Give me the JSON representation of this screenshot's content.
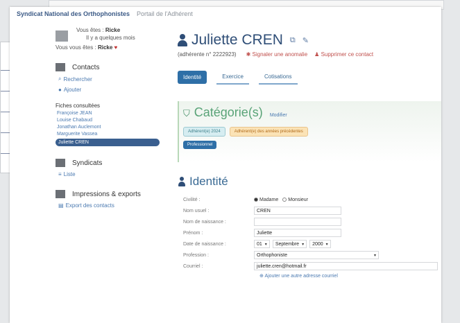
{
  "breadcrumb": {
    "brand": "Syndicat National des Orthophonistes",
    "portal": "Portail de l'Adhérent"
  },
  "user": {
    "line1_prefix": "Vous êtes :",
    "line1_name": "Ricke",
    "line2": "Il y a quelques mois",
    "line3_prefix": "Vous vous êtes :",
    "line3_value": "Ricke",
    "heart": "♥"
  },
  "sidebar": {
    "contacts_label": "Contacts",
    "contacts_links": [
      {
        "icon": "search-icon",
        "label": "Rechercher"
      },
      {
        "icon": "add-icon",
        "label": "Ajouter"
      }
    ],
    "fiches_header": "Fiches consultées",
    "fiches": [
      {
        "label": "Françoise JEAN",
        "active": false
      },
      {
        "label": "Louise Chabaud",
        "active": false
      },
      {
        "label": "Jonathan Auclemont",
        "active": false
      },
      {
        "label": "Marguerite Vassea",
        "active": false
      },
      {
        "label": "Juliette CREN",
        "active": true
      }
    ],
    "syndicats_label": "Syndicats",
    "syndicats_links": [
      {
        "label": "Liste"
      }
    ],
    "exports_label": "Impressions & exports",
    "exports_links": [
      {
        "label": "Export des contacts"
      }
    ]
  },
  "main": {
    "title": "Juliette CREN",
    "member_number": "(adhérente n° 2222923)",
    "red_action1": "Signaler une anomalie",
    "red_action2": "Supprimer ce contact",
    "tabs": [
      {
        "label": "Identité",
        "active": true
      },
      {
        "label": "Exercice",
        "active": false
      },
      {
        "label": "Cotisations",
        "active": false
      }
    ],
    "categories": {
      "title": "Catégorie(s)",
      "edit": "Modifier",
      "tags": [
        "Adhérent(e) 2024",
        "Adhérent(e) des années précédentes",
        "Professionnel"
      ]
    },
    "identite": {
      "title": "Identité",
      "fields": {
        "civilite_label": "Civilité :",
        "civilite_options": [
          "Madame",
          "Monsieur"
        ],
        "civilite_selected": "Madame",
        "nom_label": "Nom usuel :",
        "nom_value": "CREN",
        "naissance_label": "Nom de naissance :",
        "naissance_value": "",
        "prenom_label": "Prénom :",
        "prenom_value": "Juliette",
        "date_label": "Date de naissance :",
        "date_day": "01",
        "date_month": "Septembre",
        "date_year": "2000",
        "profession_label": "Profession :",
        "profession_value": "Orthophoniste",
        "email_label": "Courriel :",
        "email_value": "juliette.cren@hotmail.fr",
        "add_email": "Ajouter une autre adresse courriel"
      }
    }
  }
}
